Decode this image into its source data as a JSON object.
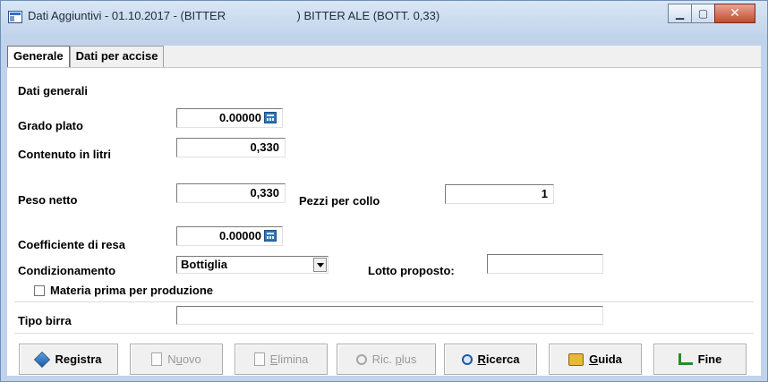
{
  "window": {
    "title": "Dati Aggiuntivi - 01.10.2017 - (BITTER                      ) BITTER ALE (BOTT. 0,33)",
    "controls": [
      "minimize-icon",
      "maximize-icon",
      "close-icon"
    ]
  },
  "tabs": [
    {
      "label": "Generale",
      "active": true
    },
    {
      "label": "Dati per accise",
      "active": false
    }
  ],
  "section_title": "Dati generali",
  "fields": {
    "grado_plato": {
      "label": "Grado plato",
      "value": "0.00000"
    },
    "contenuto_litri": {
      "label": "Contenuto in litri",
      "value": "0,330"
    },
    "peso_netto": {
      "label": "Peso netto",
      "value": "0,330"
    },
    "pezzi_collo": {
      "label": "Pezzi per collo",
      "value": "1"
    },
    "coeff_resa": {
      "label": "Coefficiente di resa",
      "value": "0.00000"
    },
    "condizionamento": {
      "label": "Condizionamento",
      "value": "Bottiglia"
    },
    "lotto_proposto": {
      "label": "Lotto proposto:",
      "value": ""
    },
    "materia_prima": {
      "label": "Materia prima per produzione",
      "checked": false
    },
    "tipo_birra": {
      "label": "Tipo birra",
      "value": ""
    }
  },
  "buttons": {
    "registra": {
      "label": "Registra",
      "icon": "save-icon",
      "enabled": true
    },
    "nuovo": {
      "prefix": "N",
      "accel": "u",
      "suffix": "ovo",
      "icon": "new-document-icon",
      "enabled": false
    },
    "elimina": {
      "prefix": "",
      "accel": "E",
      "suffix": "limina",
      "icon": "delete-document-icon",
      "enabled": false
    },
    "ric_plus": {
      "prefix": "Ric. ",
      "accel": "p",
      "suffix": "lus",
      "icon": "search-icon",
      "enabled": false
    },
    "ricerca": {
      "prefix": "",
      "accel": "R",
      "suffix": "icerca",
      "icon": "search-icon",
      "enabled": true
    },
    "guida": {
      "prefix": "",
      "accel": "G",
      "suffix": "uida",
      "icon": "book-icon",
      "enabled": true
    },
    "fine": {
      "label": "Fine",
      "icon": "exit-icon",
      "enabled": true
    }
  }
}
